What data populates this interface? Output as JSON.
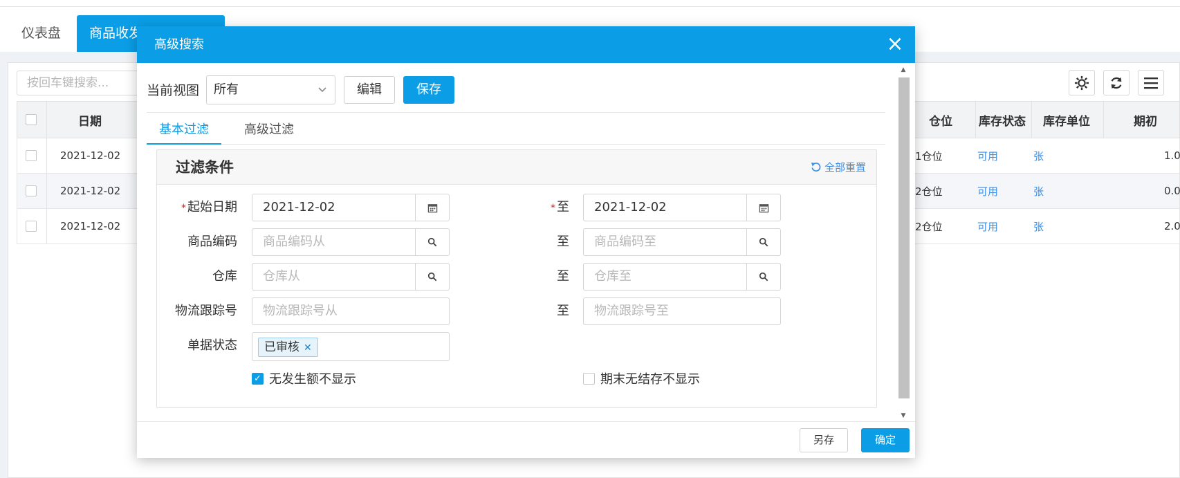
{
  "tabs": {
    "dashboard": "仪表盘",
    "active": "商品收发"
  },
  "search": {
    "placeholder": "按回车键搜索..."
  },
  "grid": {
    "headers": {
      "date": "日期",
      "location": "仓位",
      "stock_status": "库存状态",
      "stock_unit": "库存单位",
      "opening": "期初"
    },
    "rows": [
      {
        "date": "2021-12-02",
        "location": "1仓位",
        "status": "可用",
        "unit": "张",
        "opening": "1.0"
      },
      {
        "date": "2021-12-02",
        "location": "2仓位",
        "status": "可用",
        "unit": "张",
        "opening": "0.0"
      },
      {
        "date": "2021-12-02",
        "location": "2仓位",
        "status": "可用",
        "unit": "张",
        "opening": "2.0"
      }
    ]
  },
  "dialog": {
    "title": "高级搜索",
    "view_label": "当前视图",
    "view_value": "所有",
    "edit_label": "编辑",
    "save_label": "保存",
    "subtabs": {
      "basic": "基本过滤",
      "advanced": "高级过滤"
    },
    "card_title": "过滤条件",
    "reset_label": "全部重置",
    "fields": {
      "start_date_label": "起始日期",
      "start_date_from": "2021-12-02",
      "start_date_to": "2021-12-02",
      "to_label": "至",
      "goods_code_label": "商品编码",
      "goods_code_from_ph": "商品编码从",
      "goods_code_to_ph": "商品编码至",
      "warehouse_label": "仓库",
      "warehouse_from_ph": "仓库从",
      "warehouse_to_ph": "仓库至",
      "tracking_label": "物流跟踪号",
      "tracking_from_ph": "物流跟踪号从",
      "tracking_to_ph": "物流跟踪号至",
      "doc_status_label": "单据状态",
      "doc_status_tag": "已审核"
    },
    "checkbox_no_amount": "无发生额不显示",
    "checkbox_no_stock": "期末无结存不显示",
    "saveas_label": "另存",
    "ok_label": "确定"
  }
}
